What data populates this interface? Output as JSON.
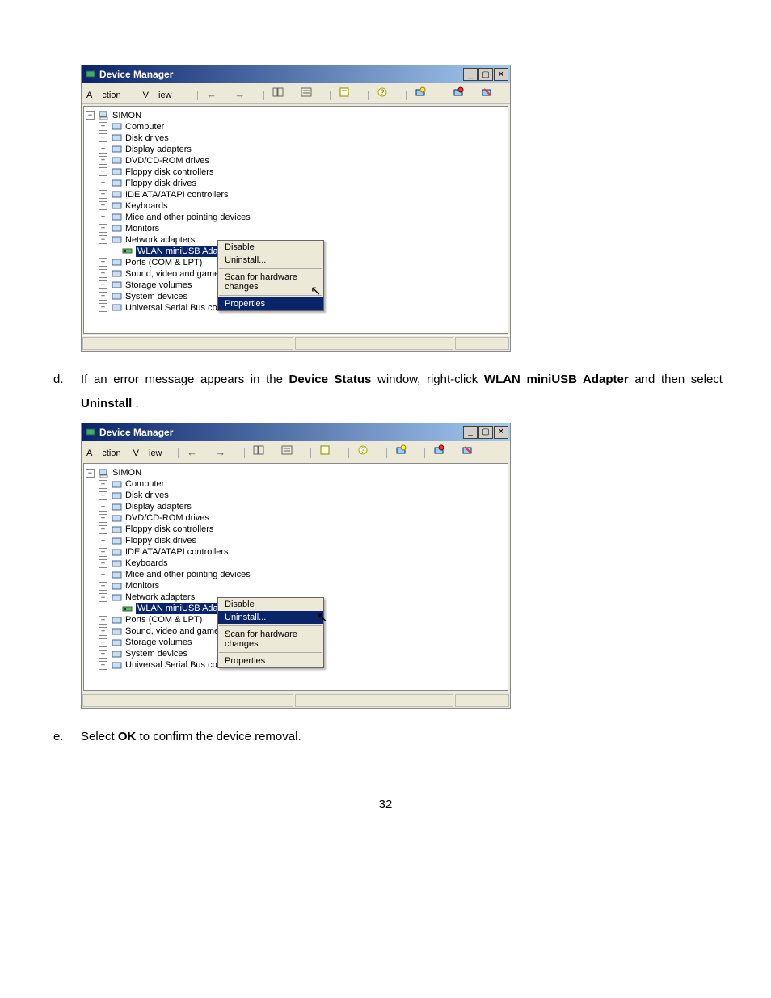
{
  "pageNumber": "32",
  "instructions": {
    "d": {
      "letter": "d.",
      "pre": "If an error message appears in the ",
      "b1": "Device Status",
      "mid1": " window, right-click ",
      "b2": "WLAN miniUSB Adapter",
      "mid2": " and then select ",
      "b3": "Uninstall",
      "post": "."
    },
    "e": {
      "letter": "e.",
      "pre": "Select ",
      "b1": "OK",
      "post": " to confirm the device removal."
    }
  },
  "win": {
    "title": "Device Manager",
    "menus": {
      "action": "Action",
      "view": "View"
    },
    "root": "SIMON",
    "nodes": [
      "Computer",
      "Disk drives",
      "Display adapters",
      "DVD/CD-ROM drives",
      "Floppy disk controllers",
      "Floppy disk drives",
      "IDE ATA/ATAPI controllers",
      "Keyboards",
      "Mice and other pointing devices",
      "Monitors",
      "Network adapters"
    ],
    "selectedChild": "WLAN miniUSB Adapter",
    "tail": [
      "Ports (COM & LPT)",
      "Sound, video and game controllers",
      "Storage volumes",
      "System devices",
      "Universal Serial Bus controllers"
    ],
    "tailShort": [
      "Ports (COM & LPT)",
      "Sound, video and game con",
      "Storage volumes",
      "System devices",
      "Universal Serial Bus controll"
    ],
    "ctx": {
      "disable": "Disable",
      "uninstall": "Uninstall...",
      "scan": "Scan for hardware changes",
      "properties": "Properties"
    }
  }
}
